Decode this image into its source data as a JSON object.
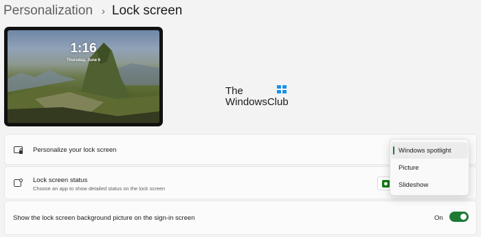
{
  "breadcrumb": {
    "parent": "Personalization",
    "separator": "›",
    "current": "Lock screen"
  },
  "preview": {
    "time": "1:16",
    "date": "Thursday, June 6"
  },
  "watermark": {
    "line1": "The",
    "line2": "WindowsClub"
  },
  "settings": {
    "personalize": {
      "title": "Personalize your lock screen",
      "icon": "lock-screen-icon"
    },
    "status": {
      "title": "Lock screen status",
      "description": "Choose an app to show detailed status on the lock screen",
      "icon": "status-icon",
      "app_icon": "app-status-icon"
    },
    "signin_background": {
      "title": "Show the lock screen background picture on the sign-in screen",
      "toggle_label": "On",
      "toggle_on": true
    }
  },
  "dropdown": {
    "options": [
      "Windows spotlight",
      "Picture",
      "Slideshow"
    ],
    "selected": "Windows spotlight"
  },
  "colors": {
    "accent": "#1d7a33",
    "page_background": "#f3f3f3",
    "card_background": "#fbfbfb"
  }
}
